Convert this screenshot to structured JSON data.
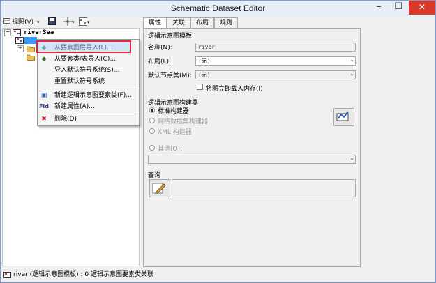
{
  "window": {
    "title": "Schematic Dataset Editor",
    "min_glyph": "–",
    "max_glyph": "☐",
    "close_glyph": "✕"
  },
  "toolbar": {
    "view_label": "视图(V)",
    "dropdown_glyph": "▾"
  },
  "tree": {
    "root_label": "riverSea",
    "expander_plus": "+",
    "expander_minus": "−"
  },
  "context_menu": {
    "items": [
      {
        "label": "从要素图层导入(L)...",
        "icon": "layer-import-icon",
        "glyph": "◆"
      },
      {
        "label": "从要素类/表导入(C)...",
        "icon": "featureclass-import-icon",
        "glyph": "◆"
      },
      {
        "label": "导入默认符号系统(S)...",
        "icon": "",
        "glyph": ""
      },
      {
        "label": "重置默认符号系统",
        "icon": "",
        "glyph": ""
      },
      {
        "label": "新建逻辑示意图要素类(F)...",
        "icon": "schematic-featureclass-icon",
        "glyph": "▣"
      },
      {
        "label": "新建属性(A)...",
        "icon": "field-icon",
        "glyph": "Fld"
      },
      {
        "label": "删除(D)",
        "icon": "delete-icon",
        "glyph": "✖"
      }
    ]
  },
  "tabs": [
    {
      "label": "属性",
      "active": true
    },
    {
      "label": "关联",
      "active": false
    },
    {
      "label": "布局",
      "active": false
    },
    {
      "label": "规则",
      "active": false
    }
  ],
  "properties": {
    "template_group": "逻辑示意图模板",
    "name_label": "名称(N):",
    "name_value": "river",
    "layout_label": "布局(L):",
    "layout_value": "(无)",
    "default_node_label": "默认节点类(M):",
    "default_node_value": "(无)",
    "load_in_memory_label": "将图立即载入内存(I)",
    "builder_group": "逻辑示意图构建器",
    "builders": [
      {
        "label": "标准构建器",
        "selected": true,
        "enabled": true
      },
      {
        "label": "网络数据集构建器",
        "selected": false,
        "enabled": false
      },
      {
        "label": "XML 构建器",
        "selected": false,
        "enabled": false
      },
      {
        "label": "其他(O):",
        "selected": false,
        "enabled": false
      }
    ],
    "query_group": "查询"
  },
  "status": {
    "text": "river (逻辑示意图模板) : 0 逻辑示意图要素类关联"
  },
  "colors": {
    "highlight_border": "#d92c36",
    "close_button": "#d9392b",
    "window_frame": "#7a9bd4"
  }
}
